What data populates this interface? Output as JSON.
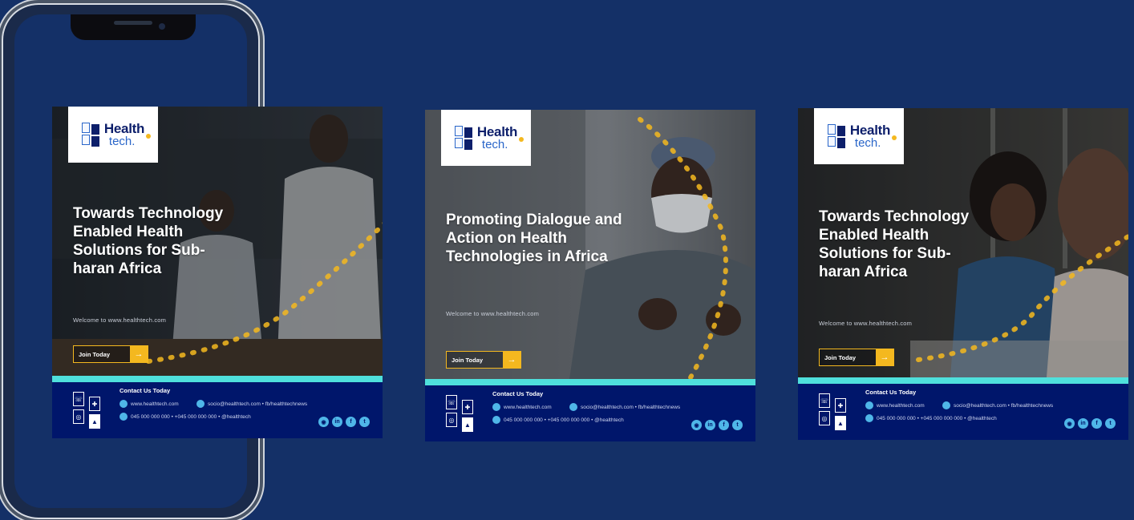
{
  "brand": {
    "logo_line1": "Health",
    "logo_line2": "tech."
  },
  "posts": [
    {
      "headline": "Towards Technology Enabled Health Solutions for Sub-haran Africa",
      "website": "Welcome to www.healthtech.com",
      "button_label": "Join Today",
      "button_arrow": "→",
      "contact_title": "Contact Us Today",
      "contact_line1": "www.healthtech.com",
      "contact_line2": "socio@healthtech.com  •  fb/healthtechnews",
      "contact_line3": "045 000 000 000  •  +045 000 000 000  •  @healthtech",
      "photo_theme": "two health workers in lab coats examining samples"
    },
    {
      "headline": "Promoting Dialogue and Action on Health Technologies in Africa",
      "website": "Welcome to www.healthtech.com",
      "button_label": "Join Today",
      "button_arrow": "→",
      "contact_title": "Contact Us Today",
      "contact_line1": "www.healthtech.com",
      "contact_line2": "socio@healthtech.com  •  fb/healthtechnews",
      "contact_line3": "045 000 000 000  •  +045 000 000 000  •  @healthtech",
      "photo_theme": "doctor in face mask with stethoscope"
    },
    {
      "headline": "Towards Technology Enabled Health Solutions for Sub-haran Africa",
      "website": "Welcome to www.healthtech.com",
      "button_label": "Join Today",
      "button_arrow": "→",
      "contact_title": "Contact Us Today",
      "contact_line1": "www.healthtech.com",
      "contact_line2": "socio@healthtech.com  •  fb/healthtechnews",
      "contact_line3": "045 000 000 000  •  +045 000 000 000  •  @healthtech",
      "photo_theme": "two women in conversation at a table"
    }
  ],
  "socials": [
    "instagram-icon",
    "linkedin-icon",
    "facebook-icon",
    "twitter-icon"
  ],
  "colors": {
    "background": "#143067",
    "footer": "#00166b",
    "accent_cyan": "#4fe0dc",
    "accent_gold": "#f4b81f",
    "logo_navy": "#0d1f6b",
    "logo_blue": "#2a66c9"
  }
}
